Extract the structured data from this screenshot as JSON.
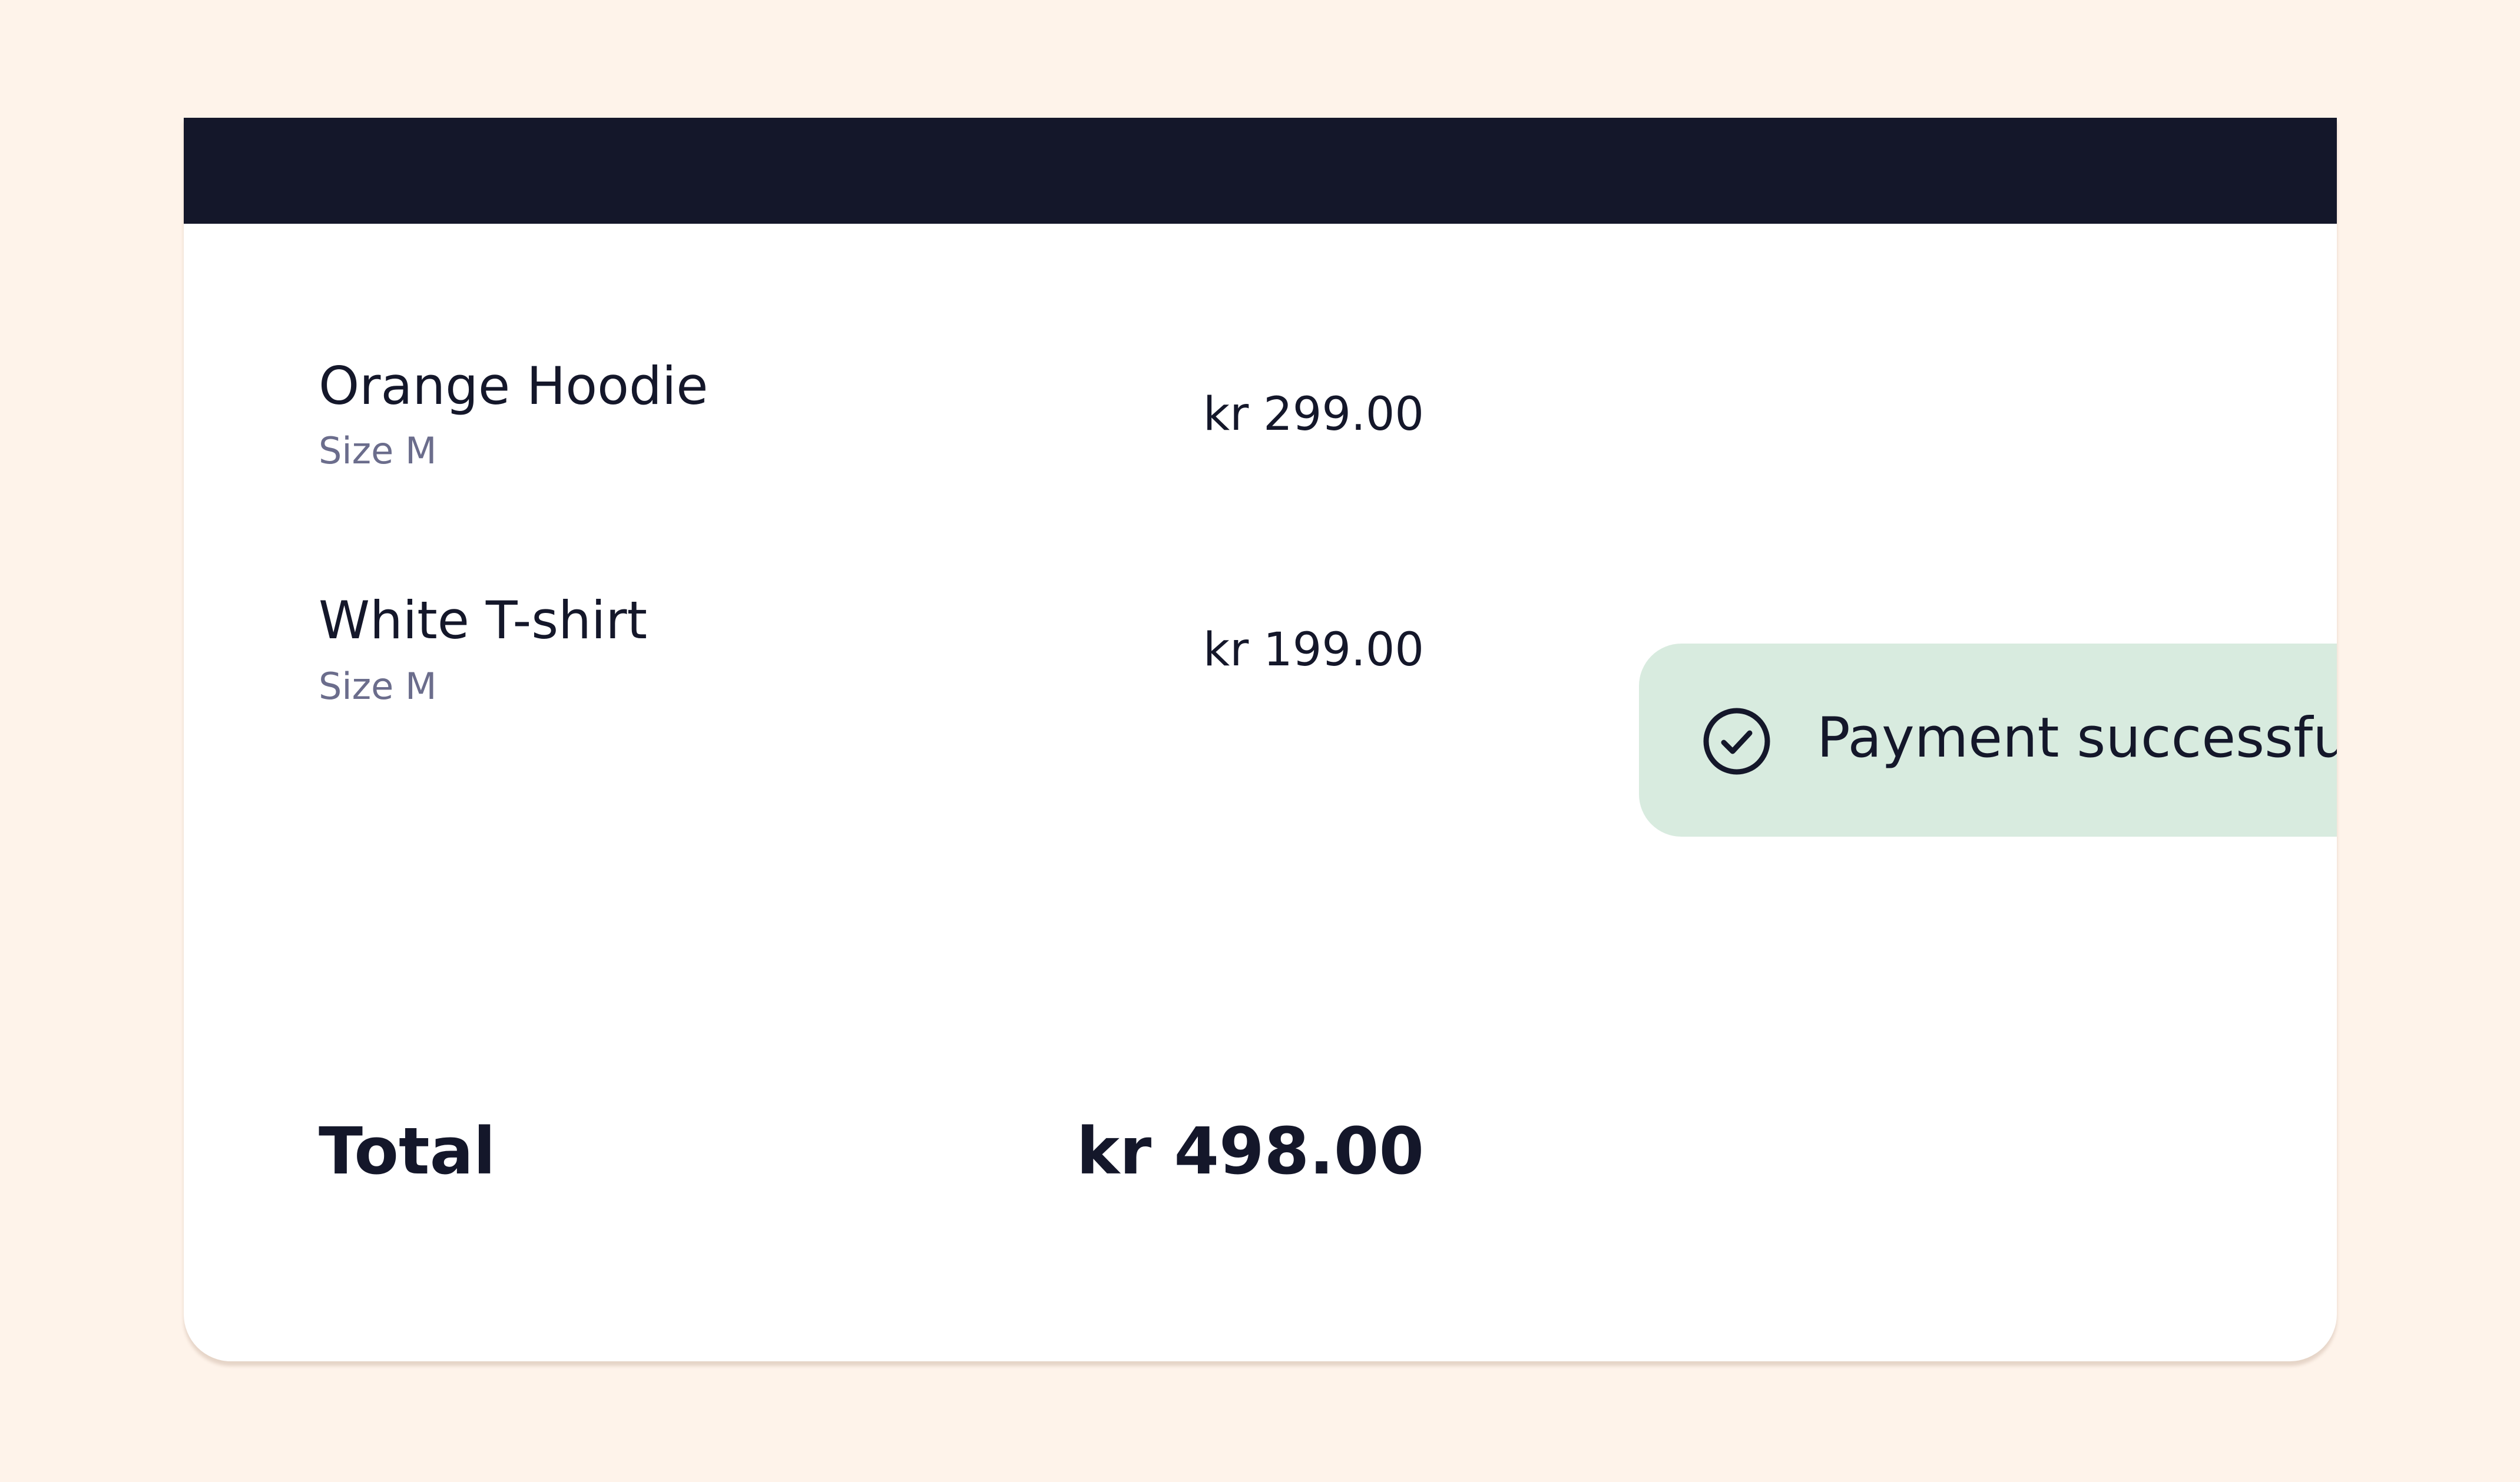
{
  "order": {
    "items": [
      {
        "name": "Orange Hoodie",
        "size": "Size M",
        "price": "kr 299.00"
      },
      {
        "name": "White T-shirt",
        "size": "Size M",
        "price": "kr 199.00"
      }
    ],
    "total_label": "Total",
    "total_value": "kr 498.00"
  },
  "toast": {
    "icon": "check-circle-icon",
    "message": "Payment successful"
  },
  "colors": {
    "page_background": "#fef3ea",
    "card_header": "#14172a",
    "text_primary": "#14172a",
    "text_secondary": "#6b6d8c",
    "toast_background": "#d8ebdf"
  }
}
